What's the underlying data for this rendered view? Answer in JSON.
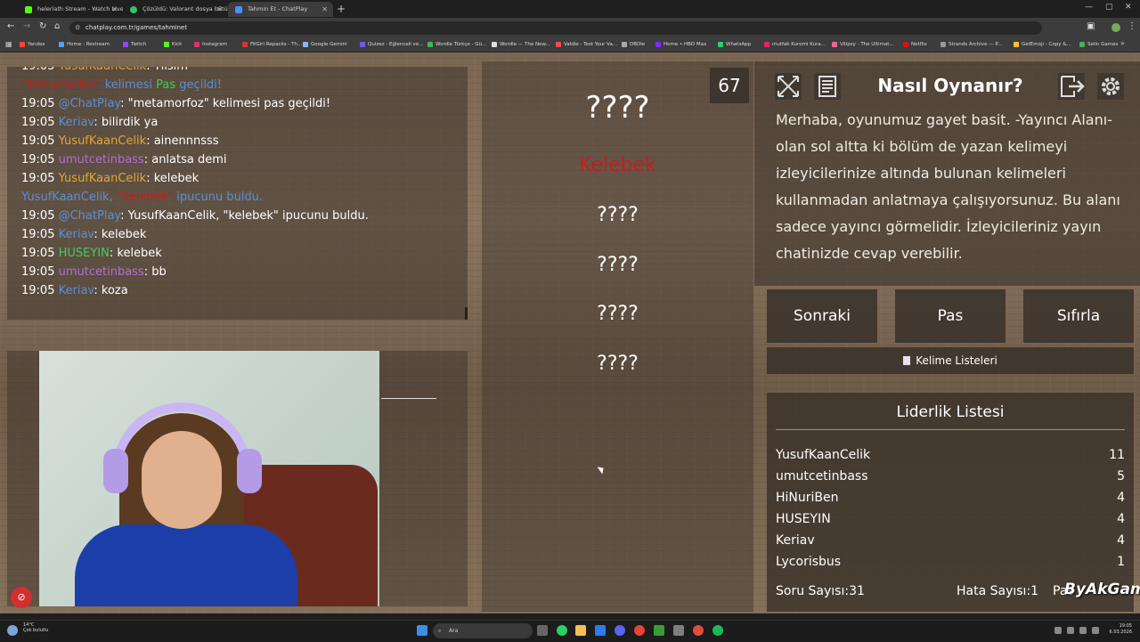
{
  "browser": {
    "tabs": [
      {
        "title": "heleriath Stream - Watch Live o",
        "color": "#53fc18"
      },
      {
        "title": "Çözüldü: Valorant dosya bütünl",
        "color": "#36c36a"
      },
      {
        "title": "Tahmin Et - ChatPlay",
        "color": "#4c8dff"
      }
    ],
    "url": "chatplay.com.tr/games/tahminet",
    "bookmarks": [
      {
        "label": "Yandex",
        "color": "#ff4433"
      },
      {
        "label": "Home - Restream",
        "color": "#4aa3ff"
      },
      {
        "label": "Twitch",
        "color": "#9146ff"
      },
      {
        "label": "Kick",
        "color": "#53fc18"
      },
      {
        "label": "Instagram",
        "color": "#e1306c"
      },
      {
        "label": "FitGirl Repacks - Th...",
        "color": "#d33"
      },
      {
        "label": "Google Gemini",
        "color": "#8ab4f8"
      },
      {
        "label": "Quizez - Eğlenceli ve...",
        "color": "#6c5ce7"
      },
      {
        "label": "Wordle Türkçe - Gü...",
        "color": "#3cba54"
      },
      {
        "label": "Wordle — The New...",
        "color": "#ddd"
      },
      {
        "label": "Valdle - Test Your Va...",
        "color": "#ff4655"
      },
      {
        "label": "DBDle",
        "color": "#aaa"
      },
      {
        "label": "Home • HBO Max",
        "color": "#7b2ff7"
      },
      {
        "label": "WhatsApp",
        "color": "#25d366"
      },
      {
        "label": "mutfak Kuromi Kura...",
        "color": "#e91e63"
      },
      {
        "label": "Vilipsy - The Ultimat...",
        "color": "#f06292"
      },
      {
        "label": "Netflix",
        "color": "#e50914"
      },
      {
        "label": "Strands Archive — P...",
        "color": "#999"
      },
      {
        "label": "GetEmoji - Copy &...",
        "color": "#fbc02d"
      },
      {
        "label": "Selin Games",
        "color": "#4caf50"
      }
    ]
  },
  "chat": {
    "lines": [
      {
        "time": "19:05",
        "user": "YusufKaanCelik",
        "userClass": "u-orange",
        "msg": ": Tılsım"
      },
      {
        "time": "",
        "user": "\"Metamorfoz\"",
        "userClass": "u-red",
        "msg": " kelimesi ",
        "msg2": "Pas",
        "msg3": " geçildi!",
        "system": true
      },
      {
        "time": "19:05",
        "user": "@ChatPlay",
        "userClass": "u-blue",
        "msg": ": \"metamorfoz\" kelimesi pas geçildi!"
      },
      {
        "time": "19:05",
        "user": "Keriav",
        "userClass": "u-blue",
        "msg": ": bilirdik ya"
      },
      {
        "time": "19:05",
        "user": "YusufKaanCelik",
        "userClass": "u-orange",
        "msg": ": ainennnsss"
      },
      {
        "time": "19:05",
        "user": "umutcetinbass",
        "userClass": "u-purple",
        "msg": ": anlatsa demi"
      },
      {
        "time": "19:05",
        "user": "YusufKaanCelik",
        "userClass": "u-orange",
        "msg": ": kelebek"
      },
      {
        "time": "",
        "user": "YusufKaanCelik,",
        "userClass": "u-blue",
        "msg": " \"Kelebek\"",
        "msg2": " ipucunu buldu.",
        "system2": true
      },
      {
        "time": "19:05",
        "user": "@ChatPlay",
        "userClass": "u-blue",
        "msg": ": YusufKaanCelik, \"kelebek\" ipucunu buldu."
      },
      {
        "time": "19:05",
        "user": "Keriav",
        "userClass": "u-blue",
        "msg": ": kelebek"
      },
      {
        "time": "19:05",
        "user": "HUSEYIN",
        "userClass": "u-green",
        "msg": ": kelebek"
      },
      {
        "time": "19:05",
        "user": "umutcetinbass",
        "userClass": "u-purple",
        "msg": ": bb"
      },
      {
        "time": "19:05",
        "user": "Keriav",
        "userClass": "u-blue",
        "msg": ": koza"
      }
    ]
  },
  "game": {
    "target_word": "????",
    "revealed_word": "Kelebek",
    "hidden_words": [
      "????",
      "????",
      "????",
      "????"
    ],
    "timer": "67"
  },
  "howto": {
    "title": "Nasıl Oynanır?",
    "text": "Merhaba, oyunumuz gayet basit. -Yayıncı Alanı- olan sol altta ki bölüm de yazan kelimeyi izleyicilerinize altında bulunan kelimeleri kullanmadan anlatmaya çalışıyorsunuz. Bu alanı sadece yayıncı görmelidir. İzleyicileriniz yayın chatinizde cevap verebilir."
  },
  "buttons": {
    "next": "Sonraki",
    "pass": "Pas",
    "reset": "Sıfırla",
    "word_lists": "Kelime Listeleri"
  },
  "leaderboard": {
    "title": "Liderlik Listesi",
    "rows": [
      {
        "name": "YusufKaanCelik",
        "score": "11"
      },
      {
        "name": "umutcetinbass",
        "score": "5"
      },
      {
        "name": "HiNuriBen",
        "score": "4"
      },
      {
        "name": "HUSEYIN",
        "score": "4"
      },
      {
        "name": "Keriav",
        "score": "4"
      },
      {
        "name": "Lycorisbus",
        "score": "1"
      }
    ]
  },
  "stats": {
    "questions": "Soru Sayısı:31",
    "errors": "Hata Sayısı:1",
    "pass": "Pas",
    "brand": "ByAkGame"
  },
  "taskbar": {
    "weather_temp": "14°C",
    "weather_desc": "Çok bulutlu",
    "search": "Ara",
    "time": "19:05",
    "date": "6.03.2026"
  }
}
